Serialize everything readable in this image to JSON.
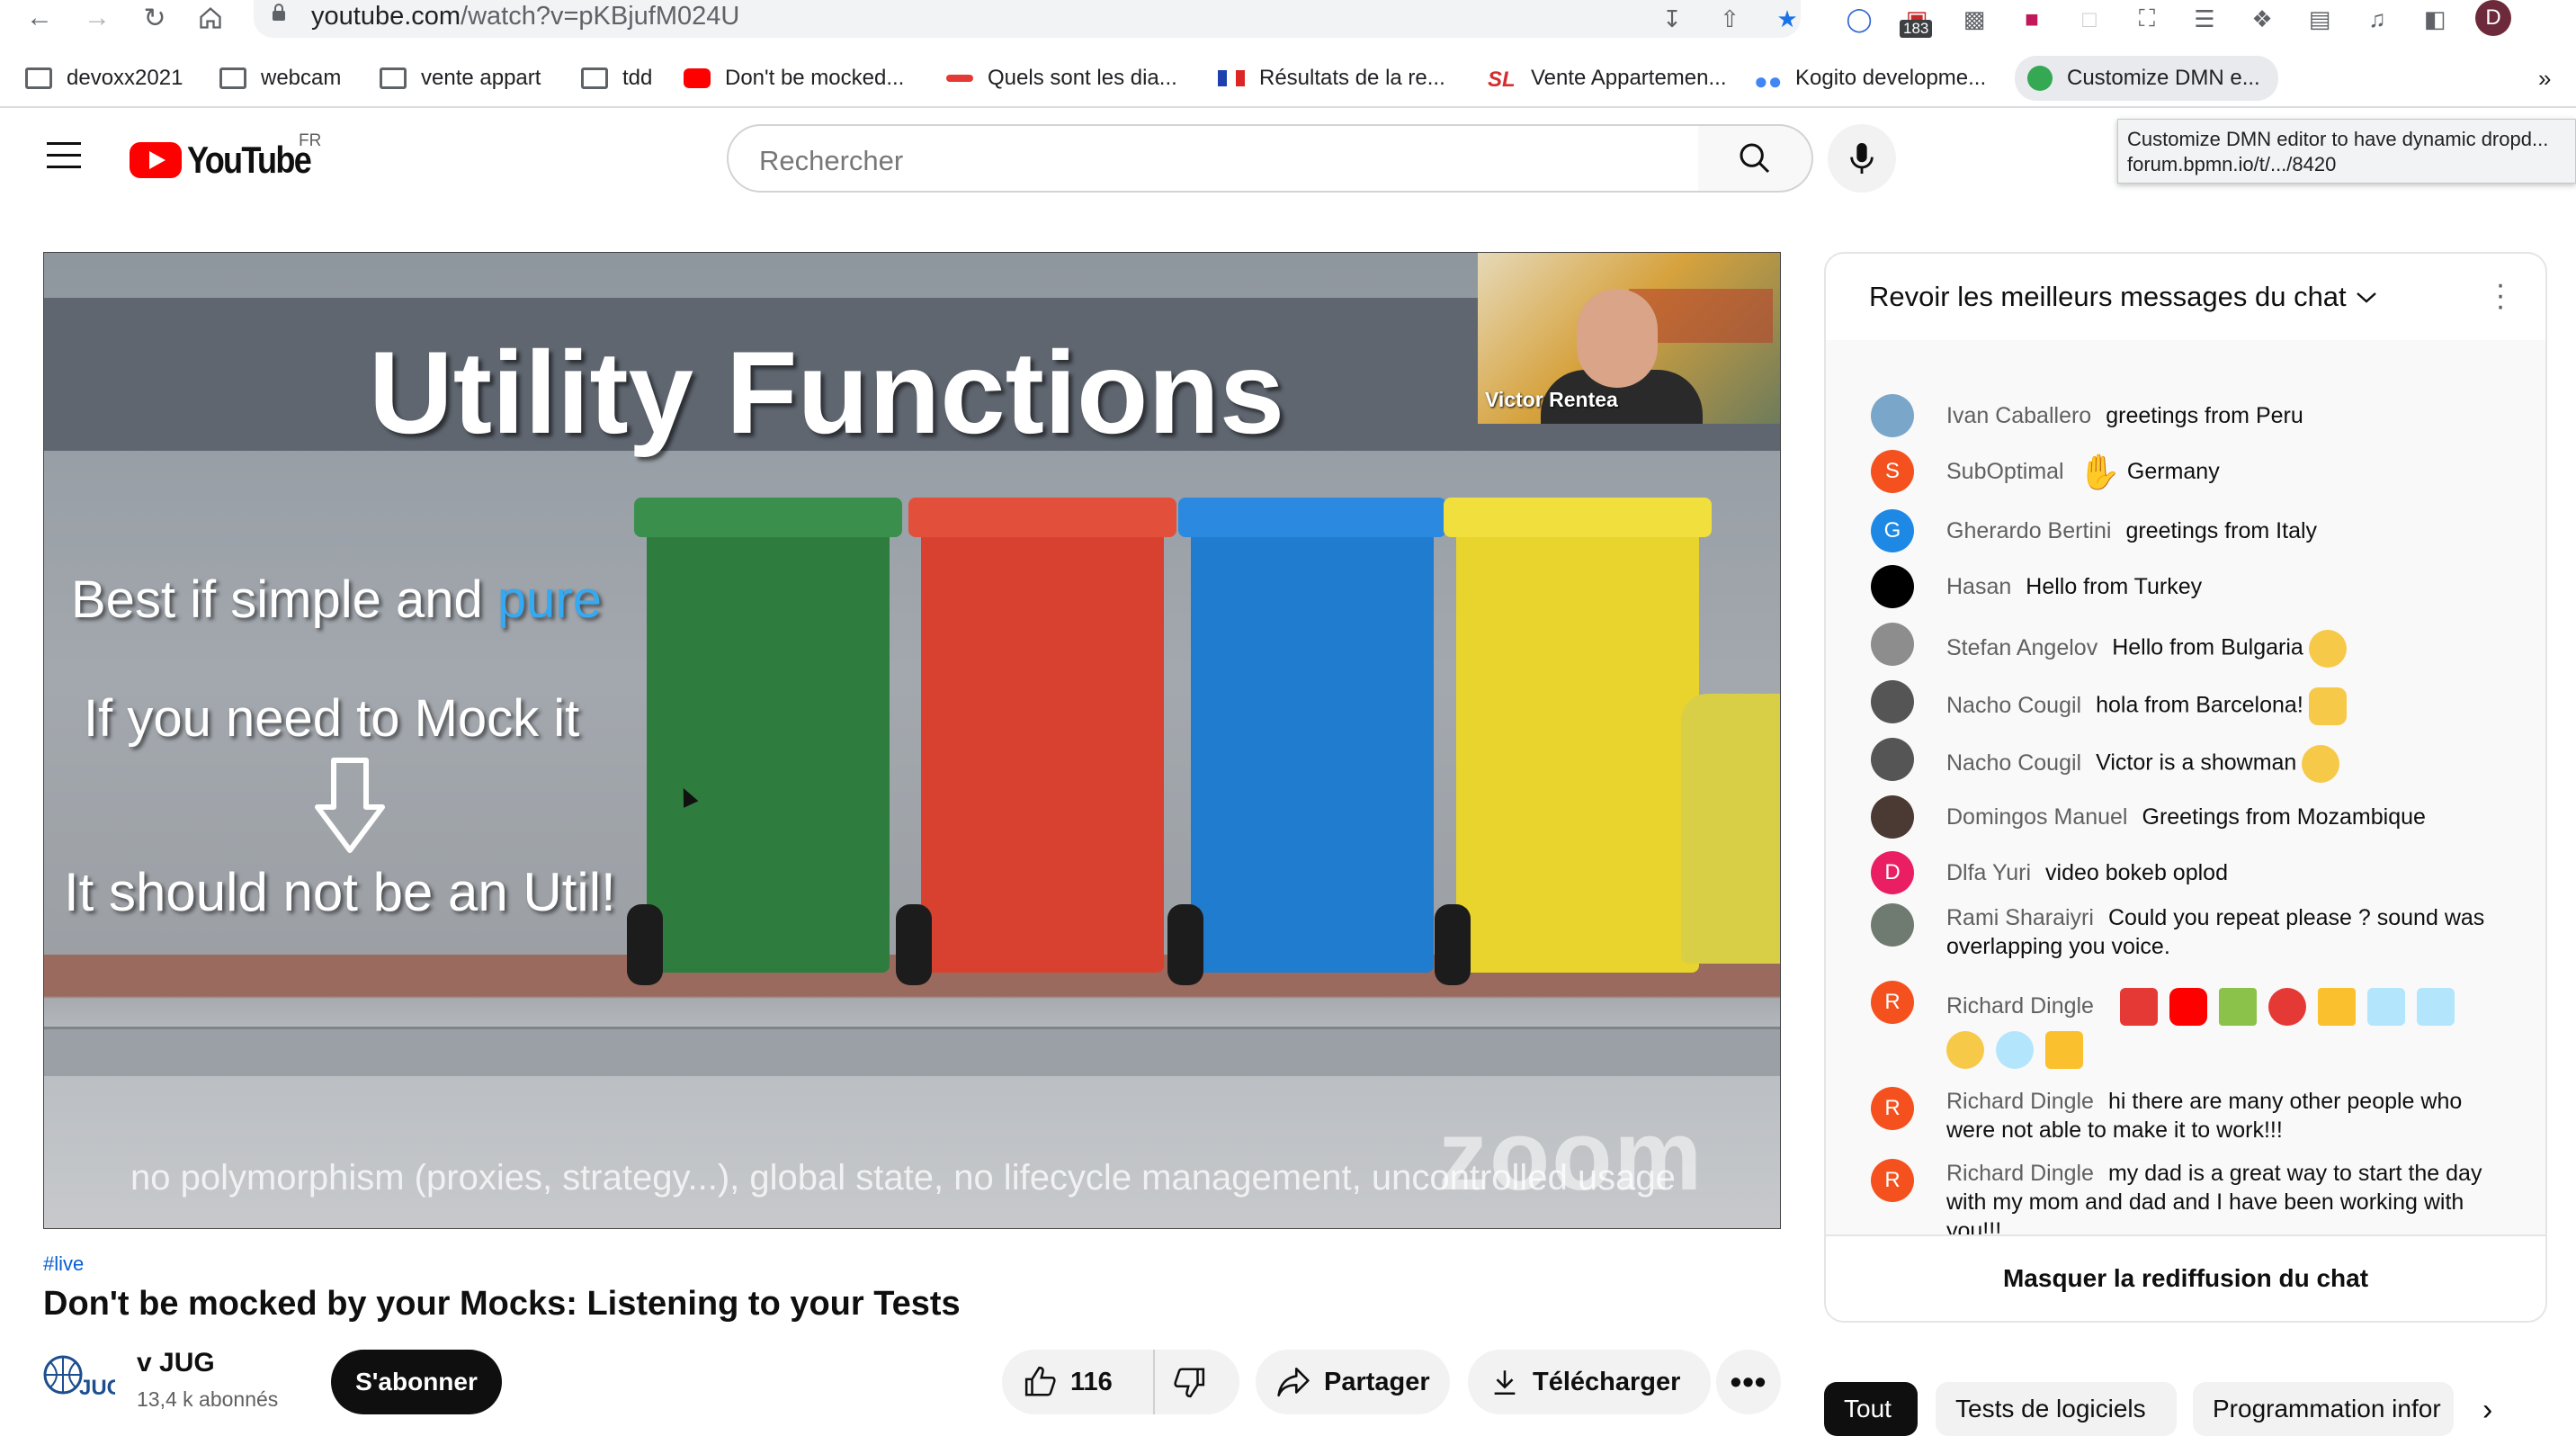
{
  "browser": {
    "url_host": "youtube.com",
    "url_path": "/watch?v=pKBjufM024U",
    "badge_count": "183",
    "profile_initial": "D",
    "bookmarks": [
      {
        "label": "devoxx2021",
        "icon": "folder-icon"
      },
      {
        "label": "webcam",
        "icon": "folder-icon"
      },
      {
        "label": "vente appart",
        "icon": "folder-icon"
      },
      {
        "label": "tdd",
        "icon": "folder-icon"
      },
      {
        "label": "Don't be mocked...",
        "icon": "youtube-icon"
      },
      {
        "label": "Quels sont les dia...",
        "icon": "site-icon"
      },
      {
        "label": "Résultats de la re...",
        "icon": "flag-icon"
      },
      {
        "label": "Vente Appartemen...",
        "icon": "sl-icon"
      },
      {
        "label": "Kogito developme...",
        "icon": "people-icon"
      },
      {
        "label": "Customize DMN e...",
        "icon": "bpmn-icon"
      }
    ],
    "tooltip_title": "Customize DMN editor to have dynamic dropd...",
    "tooltip_url": "forum.bpmn.io/t/.../8420"
  },
  "youtube": {
    "logo_text": "YouTube",
    "country": "FR",
    "search_placeholder": "Rechercher"
  },
  "video": {
    "slide_title": "Utility Functions",
    "line1_a": "Best if simple and ",
    "line1_b": "pure",
    "line2": "If you need to Mock it",
    "line3": "It should not be an Util!",
    "footer": "no polymorphism (proxies, strategy...), global state, no lifecycle management, uncontrolled usage",
    "speaker": "Victor Rentea",
    "watermark": "zoom",
    "hashtag": "#live",
    "title": "Don't be mocked by your Mocks: Listening to your Tests",
    "channel": "v JUG",
    "subscribers": "13,4 k abonnés",
    "subscribe_label": "S'abonner",
    "likes": "116",
    "share_label": "Partager",
    "download_label": "Télécharger"
  },
  "chat": {
    "header": "Revoir les meilleurs messages du chat",
    "hide_label": "Masquer la rediffusion du chat",
    "messages": [
      {
        "author": "Ivan Caballero",
        "text": "greetings from Peru",
        "initial": "",
        "color": "#7aa6c9"
      },
      {
        "author": "SubOptimal",
        "text": "Germany",
        "initial": "S",
        "color": "#f4511e"
      },
      {
        "author": "Gherardo Bertini",
        "text": "greetings from Italy",
        "initial": "G",
        "color": "#1e88e5"
      },
      {
        "author": "Hasan",
        "text": "Hello from Turkey",
        "initial": "",
        "color": "#000000"
      },
      {
        "author": "Stefan Angelov",
        "text": "Hello from Bulgaria",
        "initial": "",
        "color": "#8d8d8d"
      },
      {
        "author": "Nacho Cougil",
        "text": "hola from Barcelona!",
        "initial": "",
        "color": "#555555"
      },
      {
        "author": "Nacho Cougil",
        "text": "Victor is a showman",
        "initial": "",
        "color": "#555555"
      },
      {
        "author": "Domingos Manuel",
        "text": "Greetings from Mozambique",
        "initial": "",
        "color": "#4b3a33"
      },
      {
        "author": "Dlfa Yuri",
        "text": "video bokeb oplod",
        "initial": "D",
        "color": "#e91e63"
      },
      {
        "author": "Rami Sharaiyri",
        "text": "Could you repeat please ? sound was overlapping you voice.",
        "initial": "",
        "color": "#6f7b70"
      },
      {
        "author": "Richard Dingle",
        "text": "",
        "initial": "R",
        "color": "#f4511e"
      },
      {
        "author": "Richard Dingle",
        "text": "hi there are many other people who were not able to make it to work!!!",
        "initial": "R",
        "color": "#f4511e"
      },
      {
        "author": "Richard Dingle",
        "text": "my dad is a great way to start the day with my mom and dad and I have been working with you!!!",
        "initial": "R",
        "color": "#f4511e"
      }
    ]
  },
  "chips": [
    {
      "label": "Tout",
      "active": true
    },
    {
      "label": "Tests de logiciels",
      "active": false
    },
    {
      "label": "Programmation infor",
      "active": false
    }
  ]
}
